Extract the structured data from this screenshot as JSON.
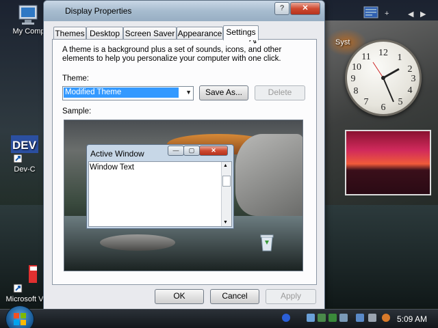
{
  "desktop": {
    "icons": [
      {
        "name": "my-computer",
        "label": "My Comp"
      },
      {
        "name": "dev-cpp",
        "label": "Dev-C"
      },
      {
        "name": "microsoft-vj",
        "label": "Microsoft V"
      }
    ],
    "gadget_label": "Syst"
  },
  "dialog": {
    "title": "Display Properties",
    "tabs": [
      "Themes",
      "Desktop",
      "Screen Saver",
      "Appearance",
      "Settings"
    ],
    "description": "A theme is a background plus a set of sounds, icons, and other elements to help you personalize your computer with one click.",
    "theme_label": "Theme:",
    "theme_value": "Modified Theme",
    "save_as_label": "Save As...",
    "delete_label": "Delete",
    "sample_label": "Sample:",
    "sample_window_title": "Active Window",
    "sample_window_text": "Window Text",
    "ok_label": "OK",
    "cancel_label": "Cancel",
    "apply_label": "Apply"
  },
  "taskbar": {
    "clock": "5:09 AM"
  },
  "colors": {
    "selection": "#3399ff",
    "close_button": "#cf4a31"
  }
}
